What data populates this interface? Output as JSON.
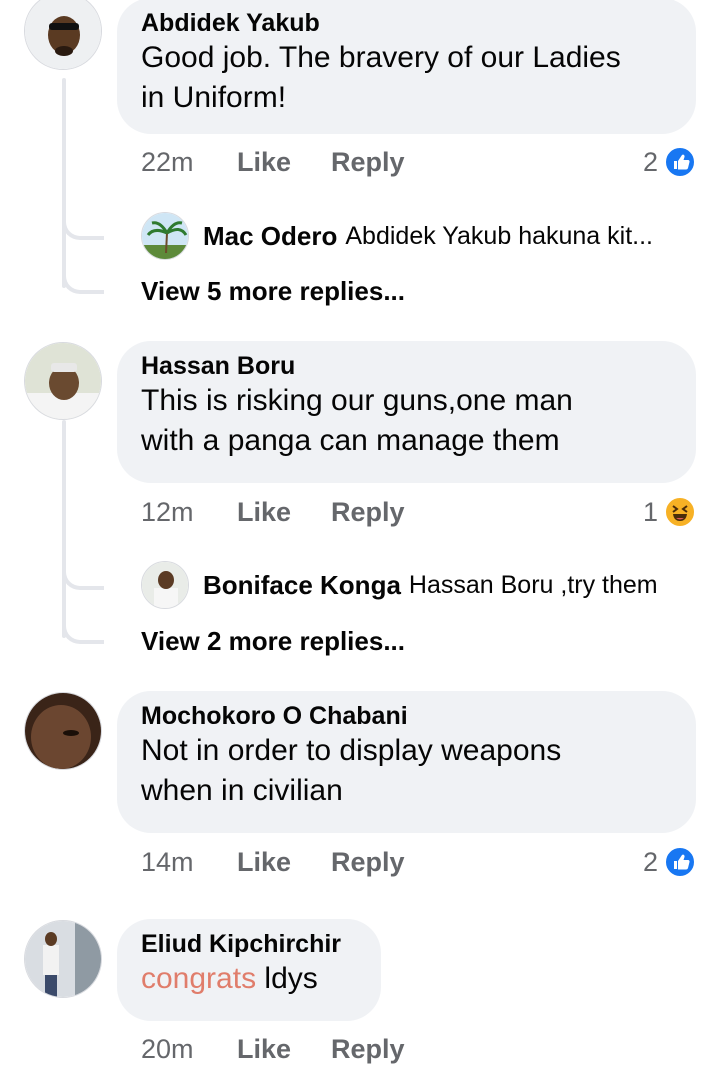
{
  "comments": [
    {
      "author": "Abdidek Yakub",
      "text_line1": "Good job. The bravery of our Ladies",
      "text_line2": "in Uniform!",
      "time": "22m",
      "like": "Like",
      "reply": "Reply",
      "reaction_count": "2",
      "reaction": "like-icon",
      "reply_preview": {
        "author": "Mac Odero",
        "text": "Abdidek Yakub hakuna kit..."
      },
      "more_replies": "View 5 more replies..."
    },
    {
      "author": "Hassan Boru",
      "text_line1": "This is risking our guns,one man",
      "text_line2": "with a panga can manage them",
      "time": "12m",
      "like": "Like",
      "reply": "Reply",
      "reaction_count": "1",
      "reaction": "haha-icon",
      "reply_preview": {
        "author": "Boniface Konga",
        "text": "Hassan Boru ,try them"
      },
      "more_replies": "View 2 more replies..."
    },
    {
      "author": "Mochokoro O Chabani",
      "text_line1": "Not in order to display weapons",
      "text_line2": "when in civilian",
      "time": "14m",
      "like": "Like",
      "reply": "Reply",
      "reaction_count": "2",
      "reaction": "like-icon"
    },
    {
      "author": "Eliud Kipchirchir",
      "tag": "congrats",
      "text_rest": " ldys",
      "time": "20m",
      "like": "Like",
      "reply": "Reply"
    }
  ],
  "colors": {
    "bubble": "#f0f2f5",
    "meta_text": "#65676b",
    "like_blue": "#1877f2",
    "haha_yellow": "#f7b125",
    "tag_text": "#e07d6b"
  }
}
